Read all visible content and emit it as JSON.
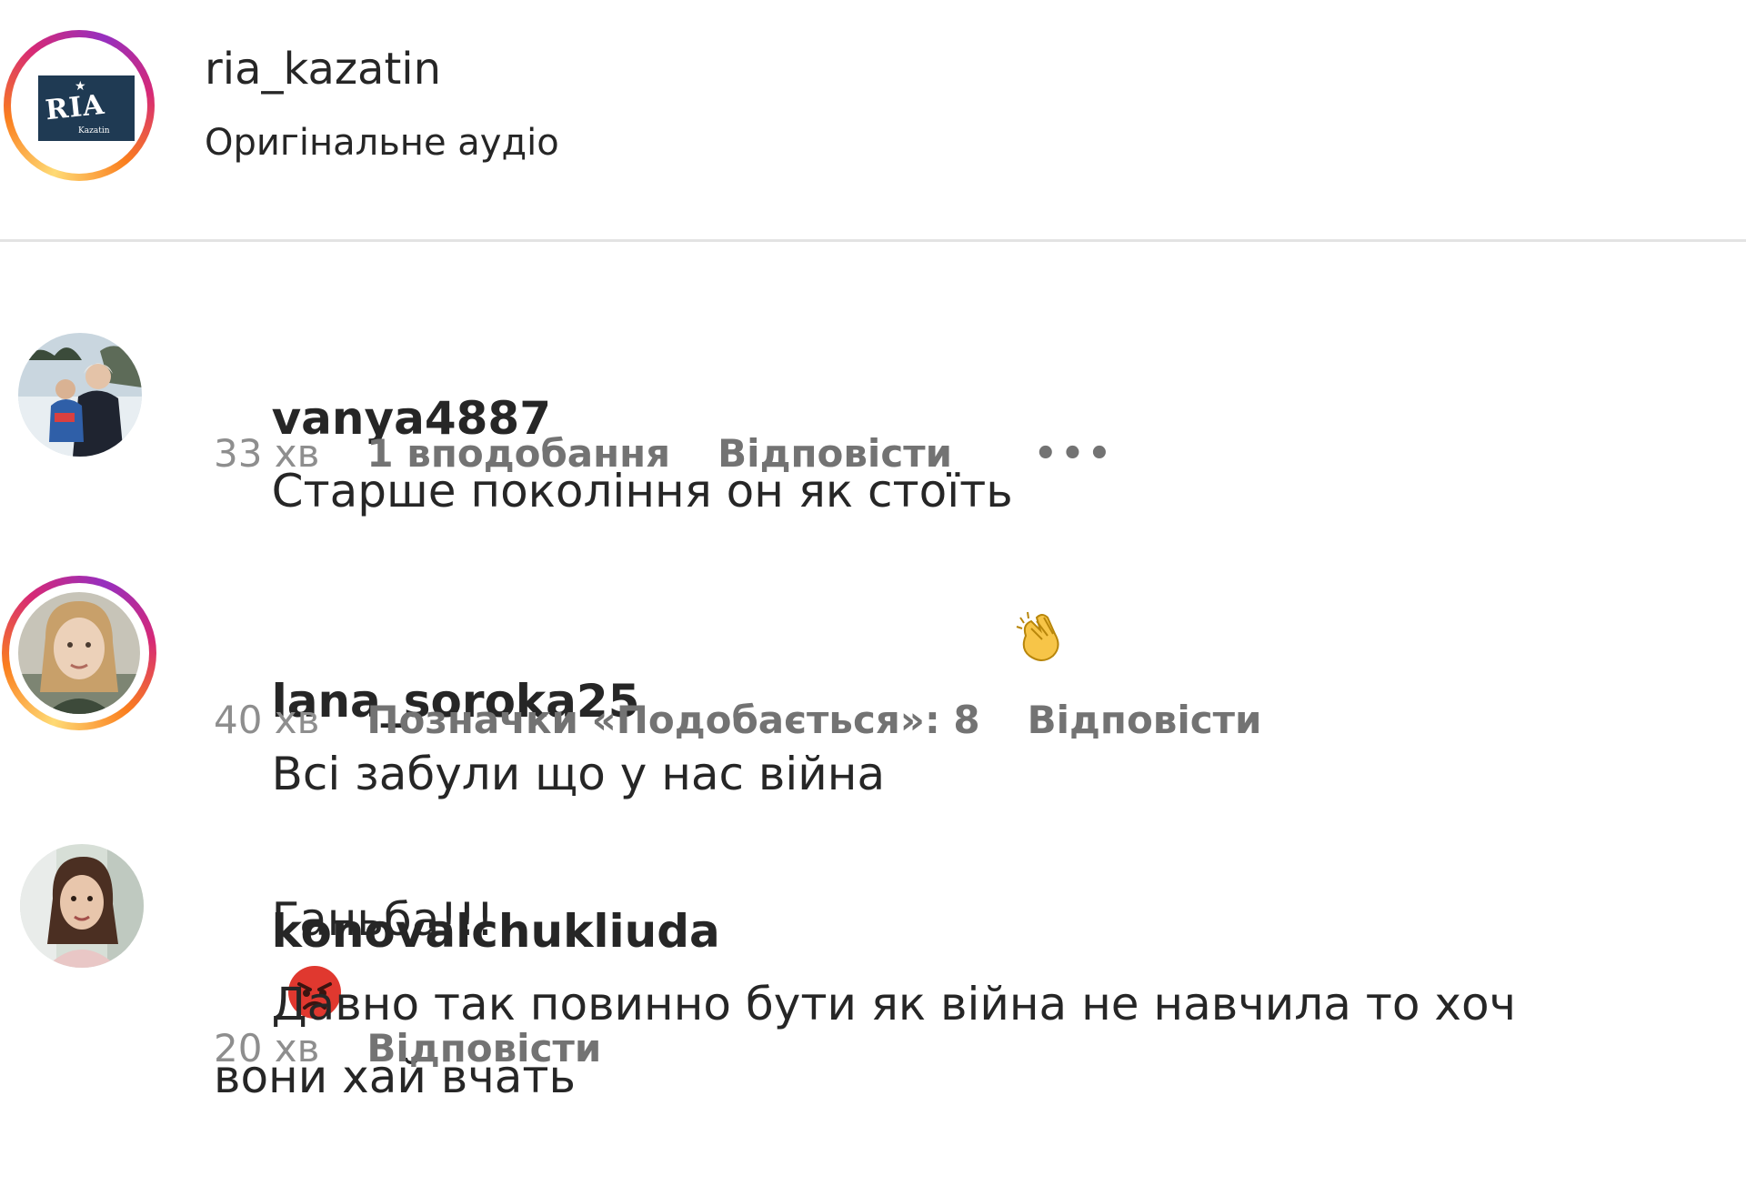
{
  "header": {
    "account": "ria_kazatin",
    "audio_label": "Оригінальне аудіо",
    "logo_text": "RIA",
    "logo_subtext": "Kazatin"
  },
  "comments": [
    {
      "username": "vanya4887",
      "text": "Старше покоління он як стоїть",
      "emoji": "clapping-hands",
      "time": "33 хв",
      "likes": "1 вподобання",
      "reply": "Відповісти",
      "more": "•••"
    },
    {
      "username": "lana_soroka25",
      "text_before": "Всі забули що у нас війна",
      "emoji": "angry-face",
      "text_after": "Ганьба!!!",
      "time": "40 хв",
      "likes": "Позначки «Подобається»: 8",
      "reply": "Відповісти"
    },
    {
      "username": "konovalchukliuda",
      "text": "Давно так повинно бути як війна не навчила то хоч вони хай вчать",
      "time": "20 хв",
      "reply": "Відповісти"
    }
  ],
  "colors": {
    "text": "#262626",
    "secondary": "#737373",
    "divider": "#e3e3e3",
    "story_ring_start": "#feda75",
    "story_ring_end": "#d62976",
    "logo_bg": "#1f3a53"
  }
}
